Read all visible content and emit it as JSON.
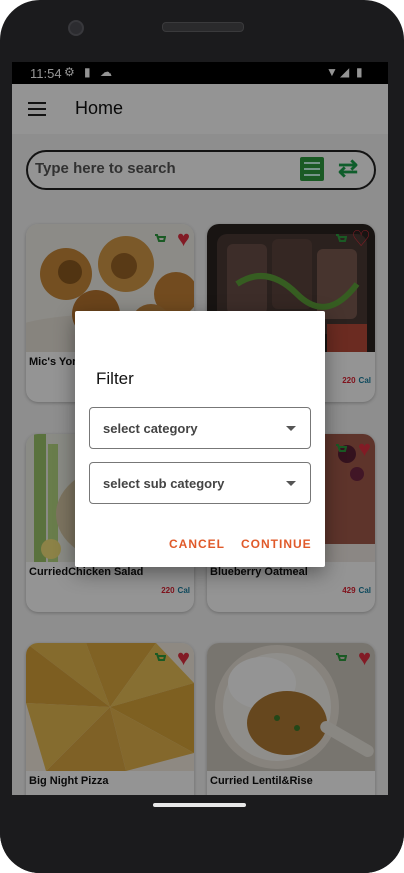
{
  "status_bar": {
    "time": "11:54"
  },
  "appbar": {
    "title": "Home"
  },
  "search": {
    "placeholder": "Type here to search"
  },
  "recipes": [
    {
      "name": "Mic's Yorkshire Puds",
      "calories": "",
      "unit": ""
    },
    {
      "name": "",
      "calories": "220",
      "unit": "Cal"
    },
    {
      "name": "CurriedChicken Salad",
      "calories": "220",
      "unit": "Cal"
    },
    {
      "name": "Blueberry Oatmeal",
      "calories": "429",
      "unit": "Cal"
    },
    {
      "name": "Big Night Pizza",
      "calories": "",
      "unit": ""
    },
    {
      "name": "Curried Lentil&Rise",
      "calories": "",
      "unit": ""
    }
  ],
  "dialog": {
    "title": "Filter",
    "category": "select category",
    "sub_category": "select sub category",
    "cancel": "CANCEL",
    "continue": "CONTINUE"
  },
  "colors": {
    "accent": "#e05a2a",
    "calories": "#dd2233",
    "cal_unit": "#1a7fa0",
    "heart": "#e03040",
    "cart": "#2e9b3e"
  },
  "icons": {
    "menu": "menu-icon",
    "filter": "filter-icon",
    "refresh": "refresh-icon",
    "cart": "cart-icon",
    "heart": "heart-icon"
  }
}
